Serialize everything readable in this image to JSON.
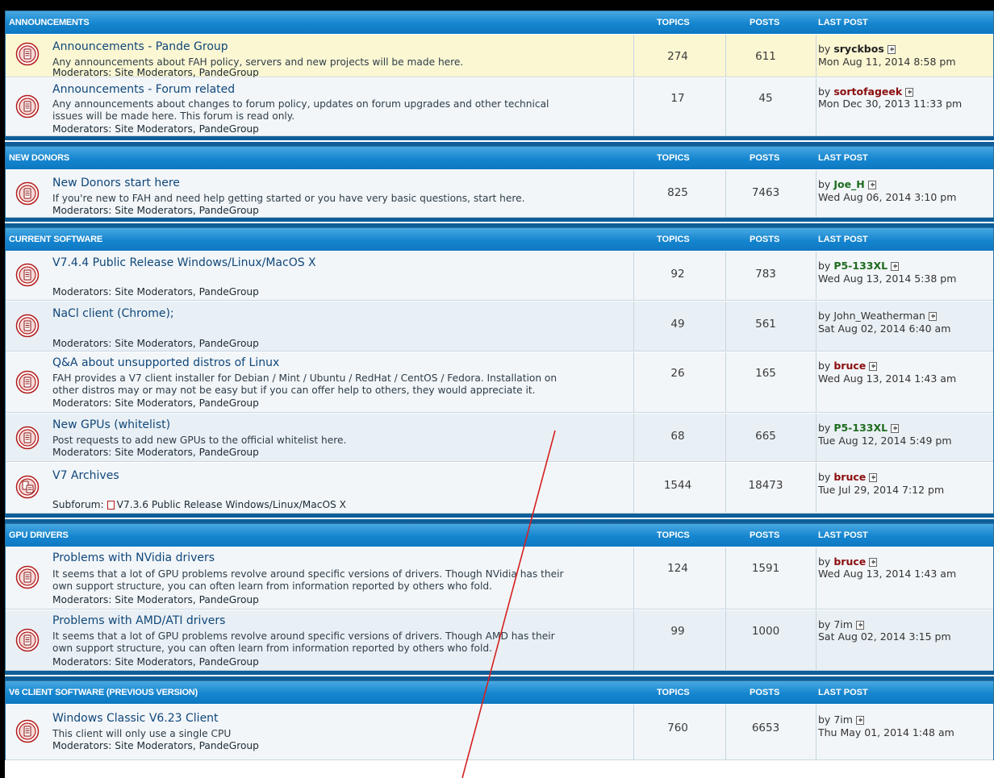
{
  "columns": {
    "topics": "TOPICS",
    "posts": "POSTS",
    "last_post": "LAST POST"
  },
  "by_prefix": "by",
  "sections": [
    {
      "title": "ANNOUNCEMENTS",
      "forums": [
        {
          "title": "Announcements - Pande Group",
          "desc": [
            "Any announcements about FAH policy, servers and new projects will be made here."
          ],
          "mods": "Moderators: Site Moderators, PandeGroup",
          "topics": "274",
          "posts": "611",
          "last_user": "sryckbos",
          "last_date": "Mon Aug 11, 2014 8:58 pm"
        },
        {
          "title": "Announcements - Forum related",
          "desc": [
            "Any announcements about changes to forum policy, updates on forum upgrades and other technical",
            "issues will be made here. This forum is read only."
          ],
          "mods": "Moderators: Site Moderators, PandeGroup",
          "topics": "17",
          "posts": "45",
          "last_user": "sortofageek",
          "last_date": "Mon Dec 30, 2013 11:33 pm"
        }
      ]
    },
    {
      "title": "NEW DONORS",
      "forums": [
        {
          "title": "New Donors start here",
          "desc": [
            "If you're new to FAH and need help getting started or you have very basic questions, start here."
          ],
          "mods": "Moderators: Site Moderators, PandeGroup",
          "topics": "825",
          "posts": "7463",
          "last_user": "Joe_H",
          "last_date": "Wed Aug 06, 2014 3:10 pm"
        }
      ]
    },
    {
      "title": "CURRENT SOFTWARE",
      "forums": [
        {
          "title": "V7.4.4 Public Release Windows/Linux/MacOS X",
          "desc": [],
          "mods": "Moderators: Site Moderators, PandeGroup",
          "topics": "92",
          "posts": "783",
          "last_user": "P5-133XL",
          "last_date": "Wed Aug 13, 2014 5:38 pm"
        },
        {
          "title": "NaCl client (Chrome);",
          "desc": [],
          "mods": "Moderators: Site Moderators, PandeGroup",
          "topics": "49",
          "posts": "561",
          "last_user": "John_Weatherman",
          "last_date": "Sat Aug 02, 2014 6:40 am"
        },
        {
          "title": "Q&A about unsupported distros of Linux",
          "desc": [
            "FAH provides a V7 client installer for Debian / Mint / Ubuntu / RedHat / CentOS / Fedora. Installation on",
            "other distros may or may not be easy but if you can offer help to others, they would appreciate it."
          ],
          "mods": "Moderators: Site Moderators, PandeGroup",
          "topics": "26",
          "posts": "165",
          "last_user": "bruce",
          "last_date": "Wed Aug 13, 2014 1:43 am"
        },
        {
          "title": "New GPUs (whitelist)",
          "desc": [
            "Post requests to add new GPUs to the official whitelist here."
          ],
          "mods": "Moderators: Site Moderators, PandeGroup",
          "topics": "68",
          "posts": "665",
          "last_user": "P5-133XL",
          "last_date": "Tue Aug 12, 2014 5:49 pm"
        },
        {
          "title": "V7 Archives",
          "desc": [],
          "subforum_label": "Subforum:",
          "subforum_link": "V7.3.6 Public Release Windows/Linux/MacOS X",
          "topics": "1544",
          "posts": "18473",
          "last_user": "bruce",
          "last_date": "Tue Jul 29, 2014 7:12 pm"
        }
      ]
    },
    {
      "title": "GPU DRIVERS",
      "forums": [
        {
          "title": "Problems with NVidia drivers",
          "desc": [
            "It seems that a lot of GPU problems revolve around specific versions of drivers. Though NVidia has their",
            "own support structure, you can often learn from information reported by others who fold."
          ],
          "mods": "Moderators: Site Moderators, PandeGroup",
          "topics": "124",
          "posts": "1591",
          "last_user": "bruce",
          "last_date": "Wed Aug 13, 2014 1:43 am"
        },
        {
          "title": "Problems with AMD/ATI drivers",
          "desc": [
            "It seems that a lot of GPU problems revolve around specific versions of drivers. Though AMD has their",
            "own support structure, you can often learn from information reported by others who fold."
          ],
          "mods": "Moderators: Site Moderators, PandeGroup",
          "topics": "99",
          "posts": "1000",
          "last_user": "7im",
          "last_date": "Sat Aug 02, 2014 3:15 pm"
        }
      ]
    },
    {
      "title": "V6 CLIENT SOFTWARE (PREVIOUS VERSION)",
      "forums": [
        {
          "title": "Windows Classic V6.23 Client",
          "desc": [
            "This client will only use a single CPU"
          ],
          "mods": "Moderators: Site Moderators, PandeGroup",
          "topics": "760",
          "posts": "6653",
          "last_user": "7im",
          "last_date": "Thu May 01, 2014 1:48 am"
        }
      ]
    }
  ],
  "colors": {
    "header_blue": "#1585cf",
    "title_blue": "#10477a",
    "highlight_row": "#fbf7d3",
    "annotation_line": "#d42020"
  },
  "icons": {
    "forum": "forum-read-icon",
    "subforum": "subforum-icon",
    "last_post": "view-latest-post-icon"
  }
}
